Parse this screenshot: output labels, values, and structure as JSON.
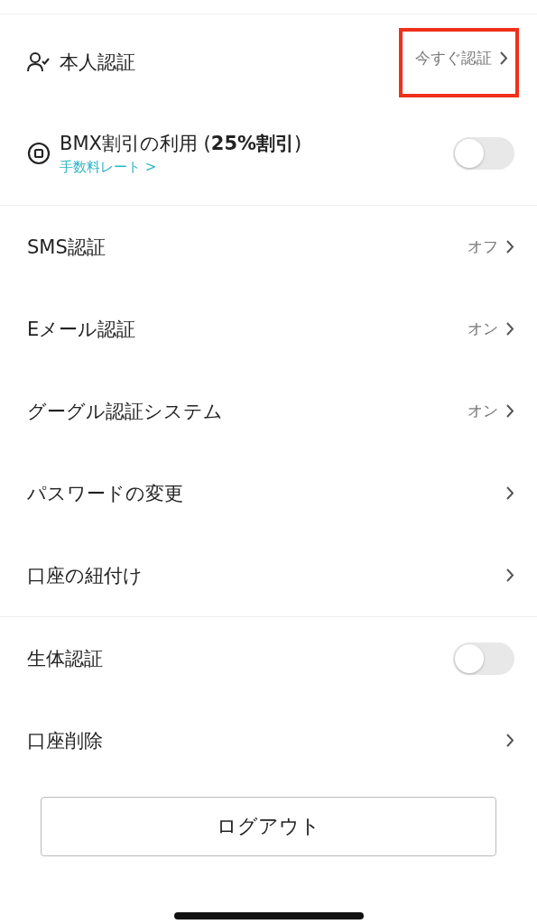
{
  "sections": [
    {
      "items": [
        {
          "kind": "link",
          "label": "本人認証",
          "value": "今すぐ認証",
          "highlighted": true
        },
        {
          "kind": "toggle",
          "label": "BMX割引の利用 (**25%割引**)",
          "sublink": "手数料レート >",
          "on": false
        }
      ]
    },
    {
      "items": [
        {
          "kind": "link",
          "label": "SMS認証",
          "value": "オフ",
          "highlighted": false
        },
        {
          "kind": "link",
          "label": "Eメール認証",
          "value": "オン",
          "highlighted": false
        },
        {
          "kind": "link",
          "label": "グーグル認証システム",
          "value": "オン",
          "highlighted": false
        },
        {
          "kind": "link",
          "label": "パスワードの変更",
          "highlighted": false
        },
        {
          "kind": "link",
          "label": "口座の紐付け",
          "highlighted": false
        }
      ]
    },
    {
      "items": [
        {
          "kind": "toggle",
          "label": "生体認証",
          "on": false
        },
        {
          "kind": "link",
          "label": "口座削除",
          "highlighted": false
        }
      ]
    }
  ],
  "logout_button": "ログアウト"
}
